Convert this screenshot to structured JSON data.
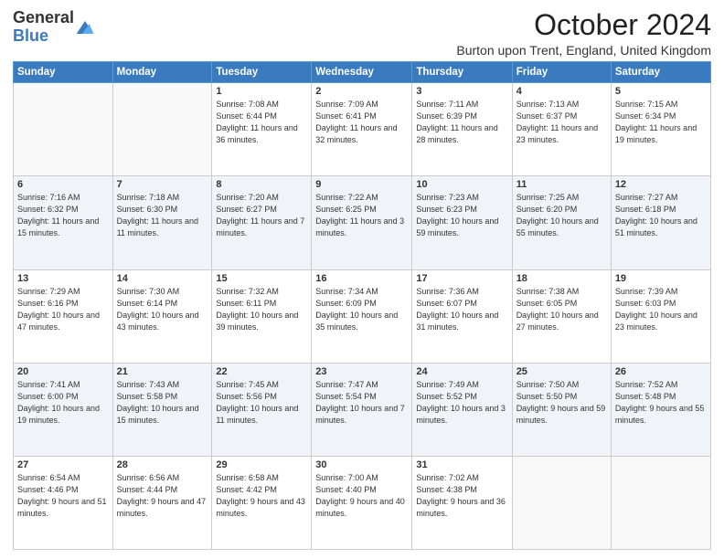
{
  "logo": {
    "general": "General",
    "blue": "Blue"
  },
  "title": "October 2024",
  "location": "Burton upon Trent, England, United Kingdom",
  "days_of_week": [
    "Sunday",
    "Monday",
    "Tuesday",
    "Wednesday",
    "Thursday",
    "Friday",
    "Saturday"
  ],
  "weeks": [
    [
      {
        "day": "",
        "sunrise": "",
        "sunset": "",
        "daylight": ""
      },
      {
        "day": "",
        "sunrise": "",
        "sunset": "",
        "daylight": ""
      },
      {
        "day": "1",
        "sunrise": "Sunrise: 7:08 AM",
        "sunset": "Sunset: 6:44 PM",
        "daylight": "Daylight: 11 hours and 36 minutes."
      },
      {
        "day": "2",
        "sunrise": "Sunrise: 7:09 AM",
        "sunset": "Sunset: 6:41 PM",
        "daylight": "Daylight: 11 hours and 32 minutes."
      },
      {
        "day": "3",
        "sunrise": "Sunrise: 7:11 AM",
        "sunset": "Sunset: 6:39 PM",
        "daylight": "Daylight: 11 hours and 28 minutes."
      },
      {
        "day": "4",
        "sunrise": "Sunrise: 7:13 AM",
        "sunset": "Sunset: 6:37 PM",
        "daylight": "Daylight: 11 hours and 23 minutes."
      },
      {
        "day": "5",
        "sunrise": "Sunrise: 7:15 AM",
        "sunset": "Sunset: 6:34 PM",
        "daylight": "Daylight: 11 hours and 19 minutes."
      }
    ],
    [
      {
        "day": "6",
        "sunrise": "Sunrise: 7:16 AM",
        "sunset": "Sunset: 6:32 PM",
        "daylight": "Daylight: 11 hours and 15 minutes."
      },
      {
        "day": "7",
        "sunrise": "Sunrise: 7:18 AM",
        "sunset": "Sunset: 6:30 PM",
        "daylight": "Daylight: 11 hours and 11 minutes."
      },
      {
        "day": "8",
        "sunrise": "Sunrise: 7:20 AM",
        "sunset": "Sunset: 6:27 PM",
        "daylight": "Daylight: 11 hours and 7 minutes."
      },
      {
        "day": "9",
        "sunrise": "Sunrise: 7:22 AM",
        "sunset": "Sunset: 6:25 PM",
        "daylight": "Daylight: 11 hours and 3 minutes."
      },
      {
        "day": "10",
        "sunrise": "Sunrise: 7:23 AM",
        "sunset": "Sunset: 6:23 PM",
        "daylight": "Daylight: 10 hours and 59 minutes."
      },
      {
        "day": "11",
        "sunrise": "Sunrise: 7:25 AM",
        "sunset": "Sunset: 6:20 PM",
        "daylight": "Daylight: 10 hours and 55 minutes."
      },
      {
        "day": "12",
        "sunrise": "Sunrise: 7:27 AM",
        "sunset": "Sunset: 6:18 PM",
        "daylight": "Daylight: 10 hours and 51 minutes."
      }
    ],
    [
      {
        "day": "13",
        "sunrise": "Sunrise: 7:29 AM",
        "sunset": "Sunset: 6:16 PM",
        "daylight": "Daylight: 10 hours and 47 minutes."
      },
      {
        "day": "14",
        "sunrise": "Sunrise: 7:30 AM",
        "sunset": "Sunset: 6:14 PM",
        "daylight": "Daylight: 10 hours and 43 minutes."
      },
      {
        "day": "15",
        "sunrise": "Sunrise: 7:32 AM",
        "sunset": "Sunset: 6:11 PM",
        "daylight": "Daylight: 10 hours and 39 minutes."
      },
      {
        "day": "16",
        "sunrise": "Sunrise: 7:34 AM",
        "sunset": "Sunset: 6:09 PM",
        "daylight": "Daylight: 10 hours and 35 minutes."
      },
      {
        "day": "17",
        "sunrise": "Sunrise: 7:36 AM",
        "sunset": "Sunset: 6:07 PM",
        "daylight": "Daylight: 10 hours and 31 minutes."
      },
      {
        "day": "18",
        "sunrise": "Sunrise: 7:38 AM",
        "sunset": "Sunset: 6:05 PM",
        "daylight": "Daylight: 10 hours and 27 minutes."
      },
      {
        "day": "19",
        "sunrise": "Sunrise: 7:39 AM",
        "sunset": "Sunset: 6:03 PM",
        "daylight": "Daylight: 10 hours and 23 minutes."
      }
    ],
    [
      {
        "day": "20",
        "sunrise": "Sunrise: 7:41 AM",
        "sunset": "Sunset: 6:00 PM",
        "daylight": "Daylight: 10 hours and 19 minutes."
      },
      {
        "day": "21",
        "sunrise": "Sunrise: 7:43 AM",
        "sunset": "Sunset: 5:58 PM",
        "daylight": "Daylight: 10 hours and 15 minutes."
      },
      {
        "day": "22",
        "sunrise": "Sunrise: 7:45 AM",
        "sunset": "Sunset: 5:56 PM",
        "daylight": "Daylight: 10 hours and 11 minutes."
      },
      {
        "day": "23",
        "sunrise": "Sunrise: 7:47 AM",
        "sunset": "Sunset: 5:54 PM",
        "daylight": "Daylight: 10 hours and 7 minutes."
      },
      {
        "day": "24",
        "sunrise": "Sunrise: 7:49 AM",
        "sunset": "Sunset: 5:52 PM",
        "daylight": "Daylight: 10 hours and 3 minutes."
      },
      {
        "day": "25",
        "sunrise": "Sunrise: 7:50 AM",
        "sunset": "Sunset: 5:50 PM",
        "daylight": "Daylight: 9 hours and 59 minutes."
      },
      {
        "day": "26",
        "sunrise": "Sunrise: 7:52 AM",
        "sunset": "Sunset: 5:48 PM",
        "daylight": "Daylight: 9 hours and 55 minutes."
      }
    ],
    [
      {
        "day": "27",
        "sunrise": "Sunrise: 6:54 AM",
        "sunset": "Sunset: 4:46 PM",
        "daylight": "Daylight: 9 hours and 51 minutes."
      },
      {
        "day": "28",
        "sunrise": "Sunrise: 6:56 AM",
        "sunset": "Sunset: 4:44 PM",
        "daylight": "Daylight: 9 hours and 47 minutes."
      },
      {
        "day": "29",
        "sunrise": "Sunrise: 6:58 AM",
        "sunset": "Sunset: 4:42 PM",
        "daylight": "Daylight: 9 hours and 43 minutes."
      },
      {
        "day": "30",
        "sunrise": "Sunrise: 7:00 AM",
        "sunset": "Sunset: 4:40 PM",
        "daylight": "Daylight: 9 hours and 40 minutes."
      },
      {
        "day": "31",
        "sunrise": "Sunrise: 7:02 AM",
        "sunset": "Sunset: 4:38 PM",
        "daylight": "Daylight: 9 hours and 36 minutes."
      },
      {
        "day": "",
        "sunrise": "",
        "sunset": "",
        "daylight": ""
      },
      {
        "day": "",
        "sunrise": "",
        "sunset": "",
        "daylight": ""
      }
    ]
  ]
}
